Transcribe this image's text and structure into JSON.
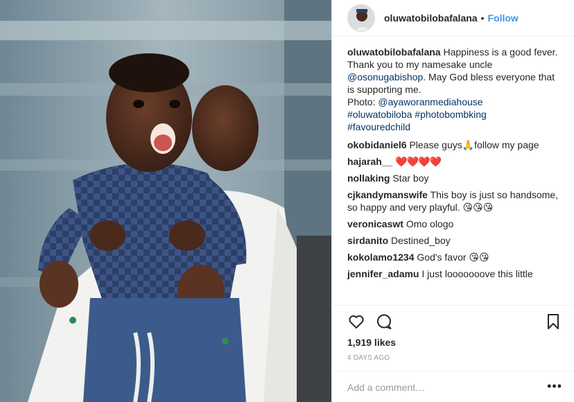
{
  "post": {
    "username": "oluwatobilobafalana",
    "follow_label": "Follow",
    "separator": "•",
    "likes": "1,919 likes",
    "date": "4 DAYS AGO",
    "comment_placeholder": "Add a comment…",
    "more_label": "•••"
  },
  "caption": {
    "username": "oluwatobilobafalana",
    "text1": "Happiness is a good fever. Thank you to my namesake uncle ",
    "mention": "@osonugabishop",
    "text2": ". May God bless everyone that is supporting me.",
    "photo_prefix": "Photo: ",
    "photo_credit": "@ayaworanmediahouse",
    "tag1": "#oluwatobiloba",
    "tag2": "#photobombking",
    "tag3": "#favouredchild"
  },
  "comments": [
    {
      "user": "okobidaniel6",
      "text": "Please guys🙏follow my page"
    },
    {
      "user": "hajarah__",
      "text": "❤️❤️❤️❤️"
    },
    {
      "user": "nollaking",
      "text": "Star boy"
    },
    {
      "user": "cjkandymanswife",
      "text": "This boy is just so handsome, so happy and very playful. 😘😘😘"
    },
    {
      "user": "veronicaswt",
      "text": "Omo ologo"
    },
    {
      "user": "sirdanito",
      "text": "Destined_boy"
    },
    {
      "user": "kokolamo1234",
      "text": "God's favor 😘😘"
    },
    {
      "user": "jennifer_adamu",
      "text": "I just looooooove this little"
    }
  ],
  "icons": {
    "like": "heart-icon",
    "comment": "comment-icon",
    "save": "bookmark-icon",
    "more": "more-icon"
  },
  "colors": {
    "follow": "#3897f0",
    "link": "#003569",
    "date": "#999999"
  }
}
